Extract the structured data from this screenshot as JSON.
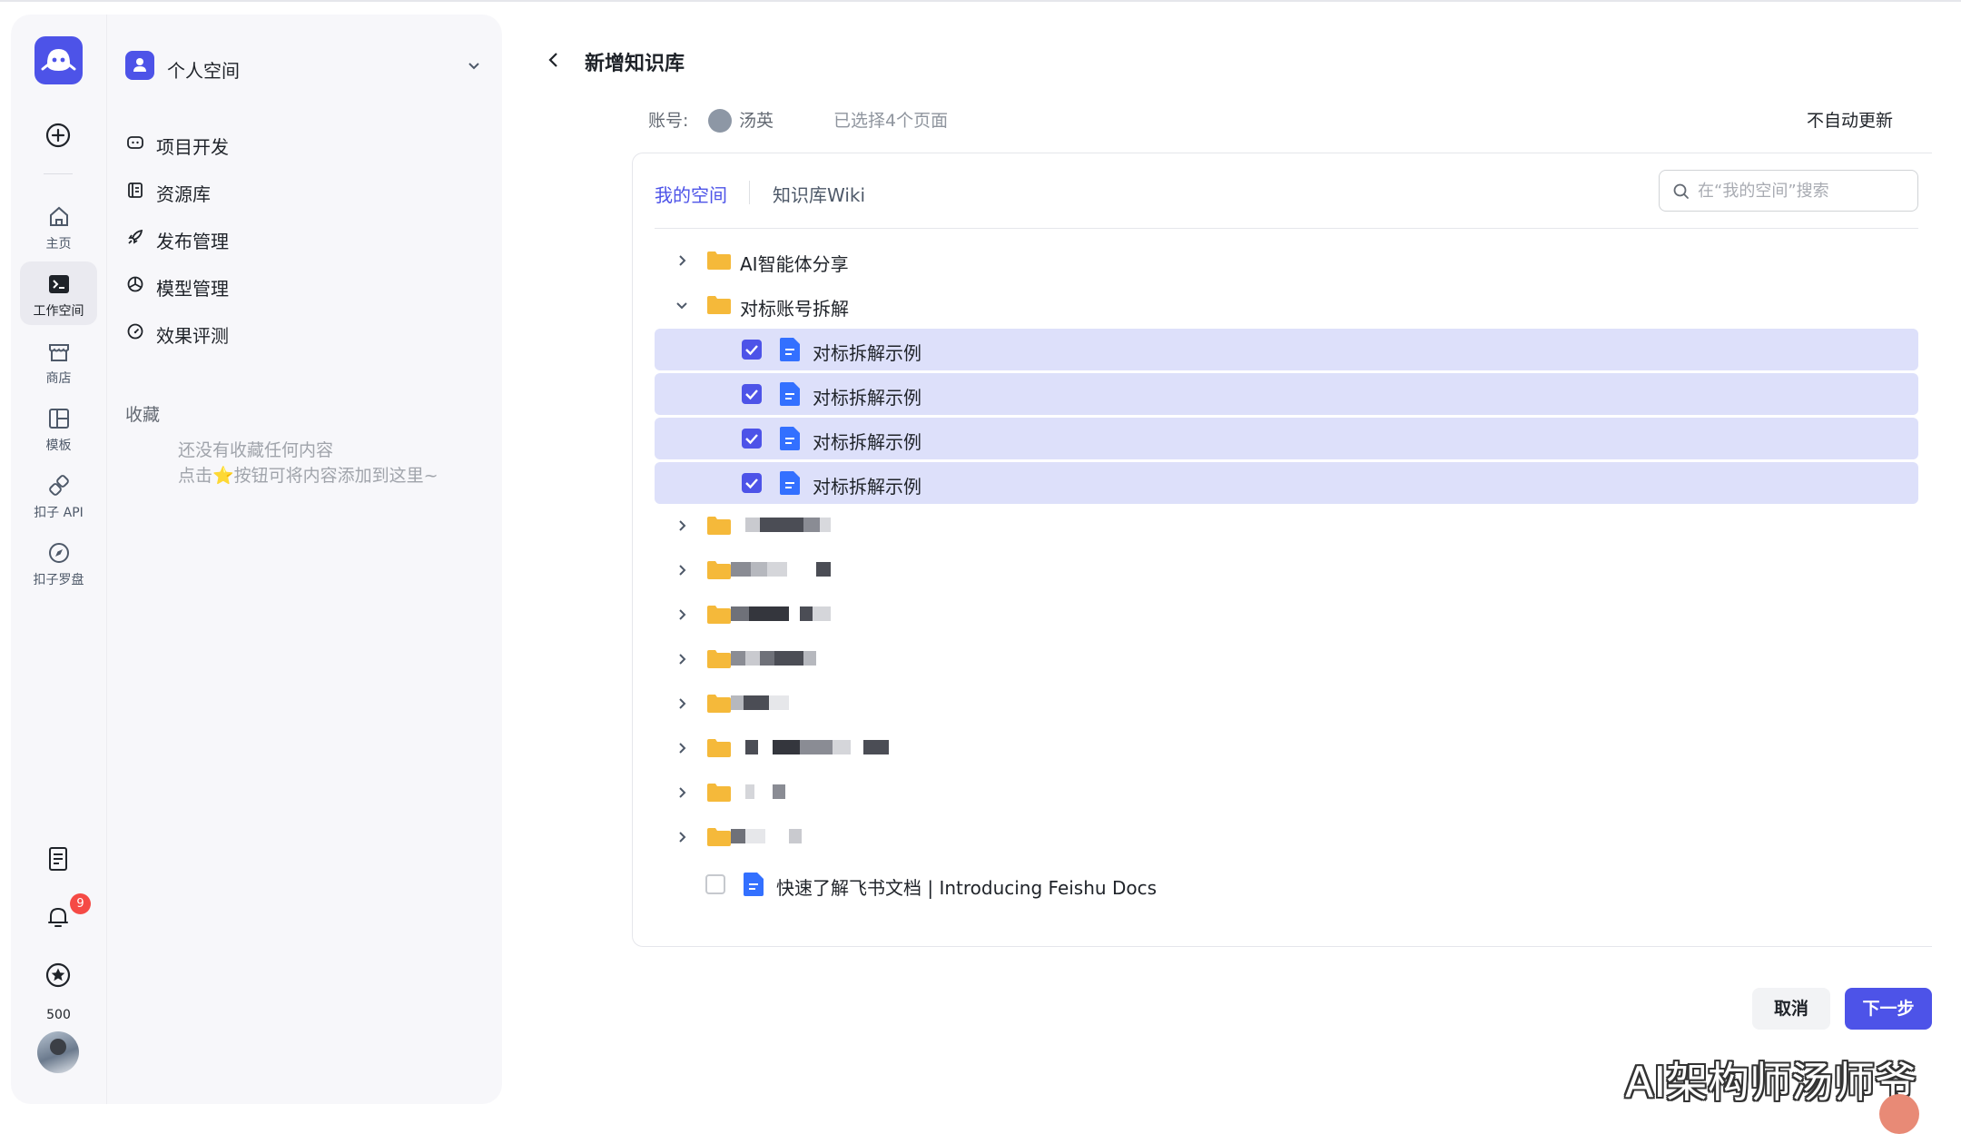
{
  "rail": {
    "items": [
      {
        "label": "主页",
        "icon": "home-icon"
      },
      {
        "label": "工作空间",
        "icon": "terminal-icon"
      },
      {
        "label": "商店",
        "icon": "store-icon"
      },
      {
        "label": "模板",
        "icon": "template-icon"
      },
      {
        "label": "扣子 API",
        "icon": "api-link-icon"
      },
      {
        "label": "扣子罗盘",
        "icon": "compass-icon"
      }
    ],
    "notification_count": "9",
    "credits": "500"
  },
  "sidebar": {
    "space_name": "个人空间",
    "nav": [
      {
        "label": "项目开发",
        "icon": "project-icon"
      },
      {
        "label": "资源库",
        "icon": "library-icon"
      },
      {
        "label": "发布管理",
        "icon": "rocket-icon"
      },
      {
        "label": "模型管理",
        "icon": "model-icon"
      },
      {
        "label": "效果评测",
        "icon": "gauge-icon"
      }
    ],
    "favorites_title": "收藏",
    "favorites_empty_line1": "还没有收藏任何内容",
    "favorites_empty_line2": "点击⭐按钮可将内容添加到这里~"
  },
  "main": {
    "title": "新增知识库",
    "account_label": "账号:",
    "account_name": "汤英",
    "selected_info": "已选择4个页面",
    "update_mode": "不自动更新",
    "tabs": [
      "我的空间",
      "知识库Wiki"
    ],
    "search_placeholder": "在“我的空间”搜索",
    "tree": {
      "folder1": "AI智能体分享",
      "folder2": "对标账号拆解",
      "children": [
        "对标拆解示例",
        "对标拆解示例",
        "对标拆解示例",
        "对标拆解示例"
      ],
      "doc": "快速了解飞书文档 | Introducing Feishu Docs"
    },
    "cancel_label": "取消",
    "next_label": "下一步"
  },
  "colors": {
    "accent": "#4d53e8",
    "selected_row": "#dde0fa",
    "folder": "#f5b93a"
  },
  "watermark": "AI架构师汤师爷"
}
